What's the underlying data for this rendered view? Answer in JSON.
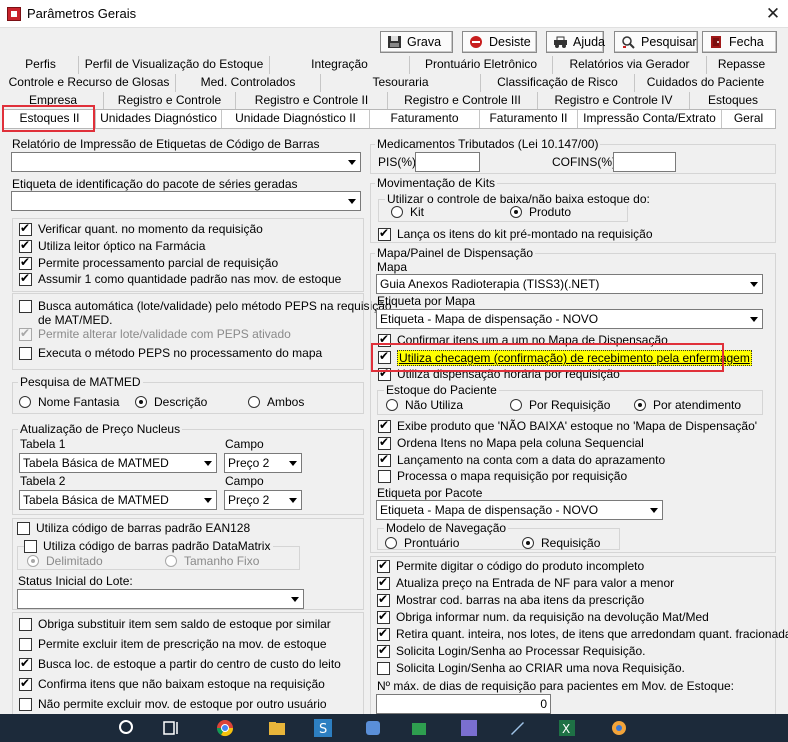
{
  "window": {
    "title": "Parâmetros Gerais"
  },
  "toolbar": {
    "grava": "Grava",
    "desiste": "Desiste",
    "ajuda": "Ajuda",
    "pesquisar": "Pesquisar",
    "fecha": "Fecha"
  },
  "tabs": {
    "row1": [
      "Perfis",
      "Perfil de Visualização do Estoque",
      "Integração",
      "Prontuário Eletrônico",
      "Relatórios via Gerador",
      "Repasse"
    ],
    "row2": [
      "Controle e Recurso de Glosas",
      "Med. Controlados",
      "Tesouraria",
      "Classificação de Risco",
      "Cuidados do Paciente"
    ],
    "row3": [
      "Empresa",
      "Registro e Controle",
      "Registro e Controle II",
      "Registro e Controle III",
      "Registro e Controle IV",
      "Estoques"
    ],
    "row4": [
      "Estoques II",
      "Unidades Diagnóstico",
      "Unidade Diagnóstico II",
      "Faturamento",
      "Faturamento II",
      "Impressão Conta/Extrato",
      "Geral"
    ]
  },
  "left": {
    "rel_label": "Relatório de Impressão de Etiquetas de Código de Barras",
    "rel_value": "",
    "etq_label": "Etiqueta de identificação do pacote de séries geradas",
    "etq_value": "",
    "g1": [
      {
        "label": "Verificar quant. no momento da requisição",
        "checked": true
      },
      {
        "label": "Utiliza leitor óptico na Farmácia",
        "checked": true
      },
      {
        "label": "Permite processamento parcial de requisição",
        "checked": true
      },
      {
        "label": "Assumir 1 como quantidade padrão nas mov. de estoque",
        "checked": true
      }
    ],
    "peps_line1": "Busca automática (lote/validade) pelo método PEPS na requisição",
    "peps_line2": "de MAT/MED.",
    "peps_alt": "Permite alterar lote/validade com PEPS ativado",
    "peps_exec": "Executa o método PEPS no processamento do mapa",
    "pesquisa_title": "Pesquisa de MATMED",
    "pesquisa_opts": [
      "Nome Fantasia",
      "Descrição",
      "Ambos"
    ],
    "atual_title": "Atualização de Preço Nucleus",
    "tabela1_label": "Tabela 1",
    "tabela1_value": "Tabela Básica de MATMED",
    "campo1_label": "Campo",
    "campo1_value": "Preço 2",
    "tabela2_label": "Tabela 2",
    "tabela2_value": "Tabela Básica de MATMED",
    "campo2_label": "Campo",
    "campo2_value": "Preço 2",
    "ean_label": "Utiliza código de barras padrão EAN128",
    "dm_label": "Utiliza código de barras padrão DataMatrix",
    "dm_opt1": "Delimitado",
    "dm_opt2": "Tamanho Fixo",
    "status_label": "Status Inicial do Lote:",
    "status_value": "",
    "g5": [
      {
        "label": "Obriga substituir item sem saldo de estoque por similar",
        "checked": false
      },
      {
        "label": "Permite excluir item de prescrição na mov. de estoque",
        "checked": false
      },
      {
        "label": "Busca loc. de estoque a partir do centro de custo do leito",
        "checked": true
      },
      {
        "label": "Confirma itens que não baixam estoque na requisição",
        "checked": true
      },
      {
        "label": "Não permite excluir mov. de estoque por outro usuário",
        "checked": false
      }
    ]
  },
  "right": {
    "med_title": "Medicamentos Tributados (Lei 10.147/00)",
    "pis_label": "PIS(%)",
    "cofins_label": "COFINS(%)",
    "kits_title": "Movimentação de Kits",
    "kits_sub": "Utilizar o controle de baixa/não baixa estoque do:",
    "kit_opt": "Kit",
    "produto_opt": "Produto",
    "lanca_kit": "Lança os itens do kit pré-montado na requisição",
    "mapa_title": "Mapa/Painel de Dispensação",
    "mapa_label": "Mapa",
    "mapa_value": "Guia Anexos Radioterapia (TISS3)(.NET)",
    "etq_mapa_label": "Etiqueta por Mapa",
    "etq_mapa_value": "Etiqueta - Mapa de dispensação - NOVO",
    "confirmar": "Confirmar itens um a um no Mapa de Dispensação",
    "checagem": "Utiliza checagem (confirmação) de recebimento pela enfermagem",
    "disp_horaria": "Utiliza dispensação horária por requisição",
    "estoque_pac": "Estoque do Paciente",
    "ep_opts": [
      "Não Utiliza",
      "Por Requisição",
      "Por atendimento"
    ],
    "m2": [
      {
        "label": "Exibe produto que 'NÃO BAIXA' estoque no 'Mapa de Dispensação'",
        "checked": true
      },
      {
        "label": "Ordena Itens no Mapa pela coluna Sequencial",
        "checked": true
      },
      {
        "label": "Lançamento na conta com a data do aprazamento",
        "checked": true
      },
      {
        "label": "Processa o mapa requisição por requisição",
        "checked": false
      }
    ],
    "etq_pacote_label": "Etiqueta por Pacote",
    "etq_pacote_value": "Etiqueta - Mapa de dispensação - NOVO",
    "nav_title": "Modelo de Navegação",
    "nav_opts": [
      "Prontuário",
      "Requisição"
    ],
    "g3": [
      {
        "label": "Permite digitar o código do produto incompleto",
        "checked": true
      },
      {
        "label": "Atualiza preço na Entrada de NF para valor a menor",
        "checked": true
      },
      {
        "label": "Mostrar cod. barras na aba itens da prescrição",
        "checked": true
      },
      {
        "label": "Obriga informar num. da requisição na devolução Mat/Med",
        "checked": true
      },
      {
        "label": "Retira quant. inteira, nos lotes, de itens que arredondam quant. fracionada",
        "checked": true
      },
      {
        "label": "Solicita Login/Senha ao Processar Requisição.",
        "checked": true
      },
      {
        "label": "Solicita Login/Senha ao CRIAR uma nova Requisição.",
        "checked": false
      }
    ],
    "dias_label": "Nº máx. de dias de requisição para pacientes em Mov. de Estoque:",
    "dias_value": "0"
  },
  "colors": {
    "highlight": "#ffff00",
    "red_annotation": "#e0303a",
    "taskbar": "#1c2a3a"
  }
}
